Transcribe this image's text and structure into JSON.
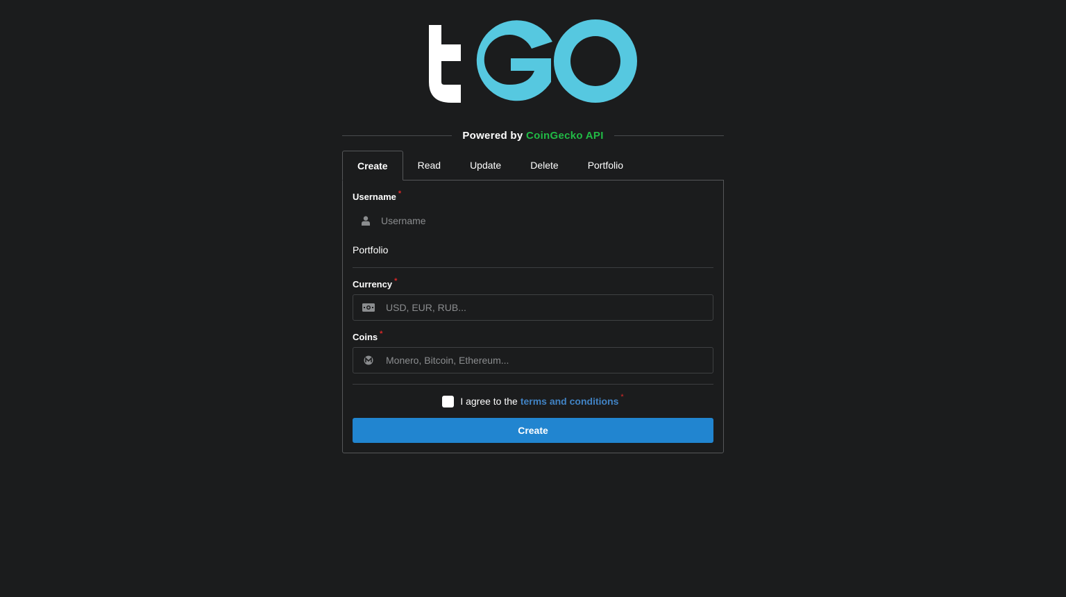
{
  "brand": {
    "logo_text": "tGO",
    "accent_color": "#56c8e0"
  },
  "powered_by": {
    "prefix": "Powered by",
    "api_name": "CoinGecko API",
    "api_color": "#21ba45"
  },
  "tabs": [
    {
      "label": "Create",
      "active": true
    },
    {
      "label": "Read",
      "active": false
    },
    {
      "label": "Update",
      "active": false
    },
    {
      "label": "Delete",
      "active": false
    },
    {
      "label": "Portfolio",
      "active": false
    }
  ],
  "form": {
    "username": {
      "label": "Username",
      "required_mark": "*",
      "placeholder": "Username",
      "value": "",
      "icon": "user-icon"
    },
    "portfolio_section": "Portfolio",
    "currency": {
      "label": "Currency",
      "required_mark": "*",
      "placeholder": "USD, EUR, RUB...",
      "value": "",
      "icon": "money-bill-icon"
    },
    "coins": {
      "label": "Coins",
      "required_mark": "*",
      "placeholder": "Monero, Bitcoin, Ethereum...",
      "value": "",
      "icon": "monero-icon"
    },
    "agree": {
      "prefix": "I agree to the",
      "link": "terms and conditions",
      "required_mark": "*",
      "checked": false
    },
    "submit_label": "Create",
    "submit_color": "#2185d0"
  }
}
